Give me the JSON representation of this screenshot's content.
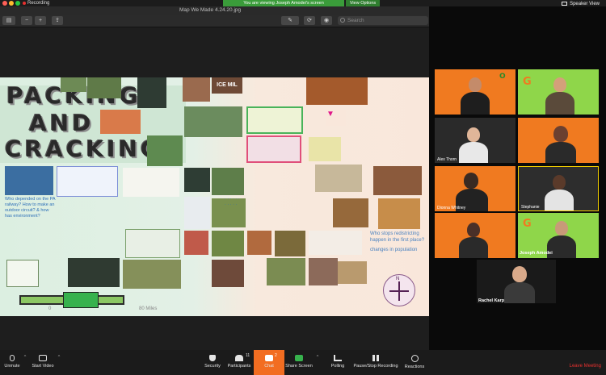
{
  "topbar": {
    "recording": "Recording",
    "viewing_banner": "You are viewing Joseph Amodei's screen",
    "view_options": "View Options",
    "speaker_view": "Speaker View"
  },
  "preview": {
    "file_title": "Map We Made 4.24.20.jpg",
    "search_placeholder": "Search"
  },
  "map": {
    "title_line1": "PACKING",
    "title_line2": "AND",
    "title_line3": "CRACKING",
    "sign_text": "ICE MIL",
    "question_left": "Who depended on the PA railway? How to make an outdoor circuit? & how has environment?",
    "question_right_1": "Who stops redistricting happen in the first place?",
    "question_right_2": "changes in population",
    "scale_zero": "0",
    "scale_miles": "80 Miles",
    "compass_label": "N"
  },
  "gallery": {
    "tiles": [
      {
        "name": "",
        "bg": "#f07a20"
      },
      {
        "name": "",
        "bg": "#8fd64a"
      },
      {
        "name": "Alex Thorn",
        "bg": "#2a2a2a"
      },
      {
        "name": "",
        "bg": "#f07a20"
      },
      {
        "name": "Dionna Whitney",
        "bg": "#f07a20"
      },
      {
        "name": "Stephanie",
        "bg": "#2d2d2d"
      },
      {
        "name": "",
        "bg": "#f07a20"
      },
      {
        "name": "Joseph Amodei",
        "bg": "#8fd64a"
      }
    ],
    "speaker_name": "Rachel Karp"
  },
  "controls": {
    "unmute": "Unmute",
    "start_video": "Start Video",
    "security": "Security",
    "participants": "Participants",
    "participants_count": "11",
    "chat": "Chat",
    "chat_count": "2",
    "share_screen": "Share Screen",
    "polling": "Polling",
    "pause_recording": "Pause/Stop Recording",
    "reactions": "Reactions",
    "leave_meeting": "Leave Meeting"
  },
  "colors": {
    "accent_orange": "#f26d21",
    "banner_green": "#3a9c3a",
    "leave_red": "#e8312f"
  }
}
